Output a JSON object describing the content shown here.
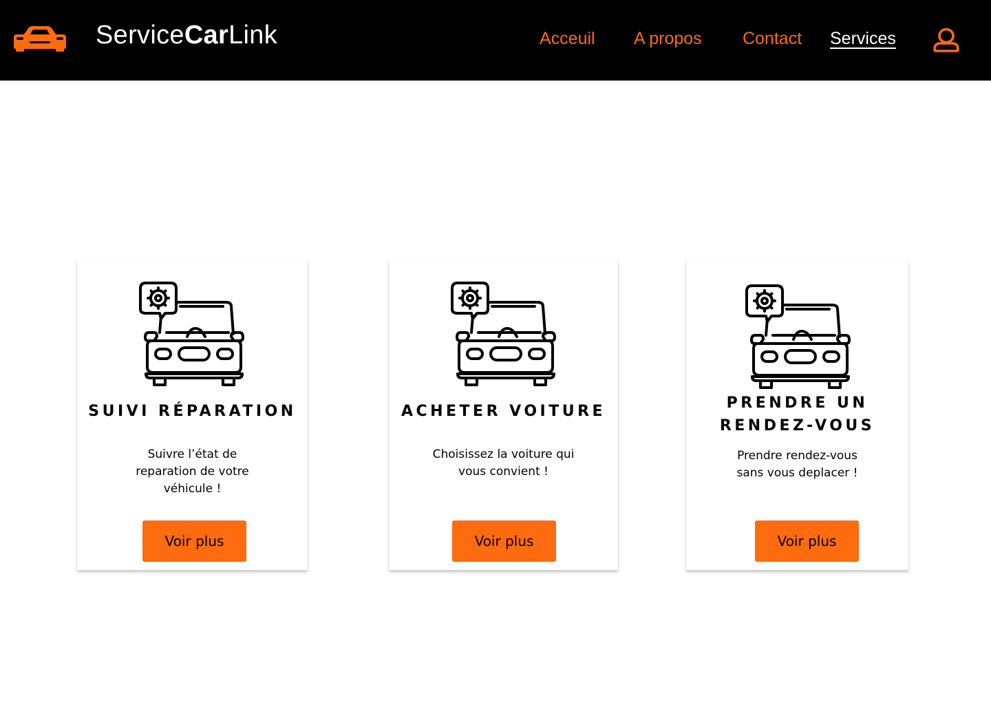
{
  "header": {
    "brand_prefix": "Service",
    "brand_bold": "Car",
    "brand_suffix": "Link",
    "nav": [
      {
        "label": "Acceuil"
      },
      {
        "label": "A propos"
      },
      {
        "label": "Contact"
      },
      {
        "label": "Services",
        "active": true
      }
    ],
    "user_icon": "user-icon",
    "logo_icon": "car-icon"
  },
  "cards": [
    {
      "icon": "car-repair-icon",
      "title": "SUIVI RÉPARATION",
      "text_lines": [
        "Suivre l’état de",
        "reparation de votre",
        "véhicule !"
      ],
      "button": "Voir plus"
    },
    {
      "icon": "car-repair-icon",
      "title": "ACHETER VOITURE",
      "text_lines": [
        "Choisissez la voiture qui",
        "vous convient !"
      ],
      "button": "Voir plus"
    },
    {
      "icon": "car-repair-icon",
      "title_lines": [
        "PRENDRE UN",
        "RENDEZ-VOUS"
      ],
      "text_lines": [
        "Prendre rendez-vous",
        "sans vous deplacer !"
      ],
      "button": "Voir plus"
    }
  ],
  "colors": {
    "accent": "#ff6b0f",
    "header_bg": "#000000",
    "page_bg": "#ffffff"
  }
}
